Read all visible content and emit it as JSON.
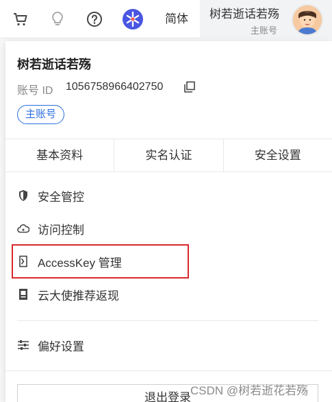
{
  "topbar": {
    "icons": [
      "cart-icon",
      "lightbulb-icon",
      "help-icon",
      "app-logo-icon"
    ],
    "language_label": "简体",
    "user_name": "树若逝话若殇",
    "user_role": "主账号"
  },
  "panel": {
    "name": "树若逝话若殇",
    "account_label": "账号 ID",
    "account_id": "1056758966402750",
    "badge": "主账号",
    "tabs": [
      {
        "label": "基本资料"
      },
      {
        "label": "实名认证"
      },
      {
        "label": "安全设置"
      }
    ],
    "menu": [
      {
        "label": "安全管控",
        "icon": "shield-icon"
      },
      {
        "label": "访问控制",
        "icon": "cloud-icon"
      },
      {
        "label": "AccessKey 管理",
        "icon": "key-icon"
      },
      {
        "label": "云大使推荐返现",
        "icon": "document-icon"
      }
    ],
    "preferences": {
      "label": "偏好设置",
      "icon": "sliders-icon"
    },
    "logout": "退出登录",
    "accent_color": "#2a6ee0",
    "highlight_color": "#d9262b"
  },
  "watermark": "CSDN @树若逝花若殇"
}
